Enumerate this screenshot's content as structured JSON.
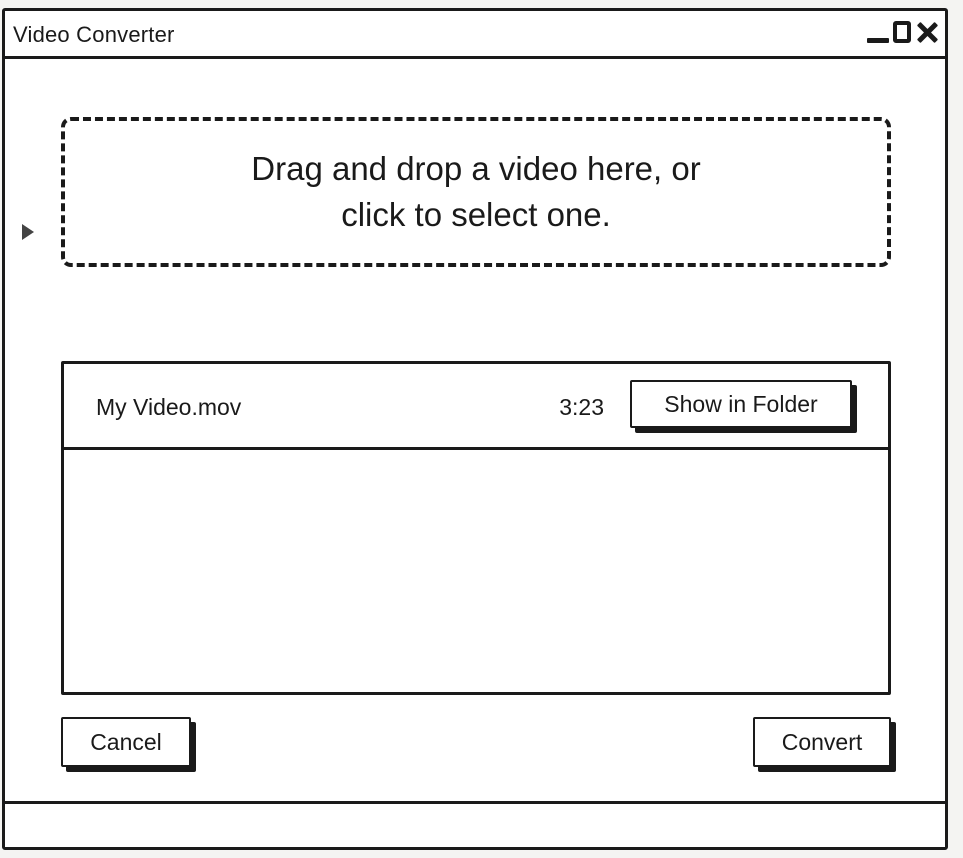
{
  "window": {
    "title": "Video Converter"
  },
  "dropzone": {
    "line1": "Drag and drop a video here, or",
    "line2": "click to select one."
  },
  "files": [
    {
      "name": "My Video.mov",
      "duration": "3:23",
      "action_label": "Show in Folder"
    }
  ],
  "actions": {
    "cancel_label": "Cancel",
    "convert_label": "Convert"
  },
  "icons": {
    "minimize": "minimize-icon",
    "maximize": "maximize-icon",
    "close": "close-icon",
    "cursor": "cursor-icon"
  }
}
